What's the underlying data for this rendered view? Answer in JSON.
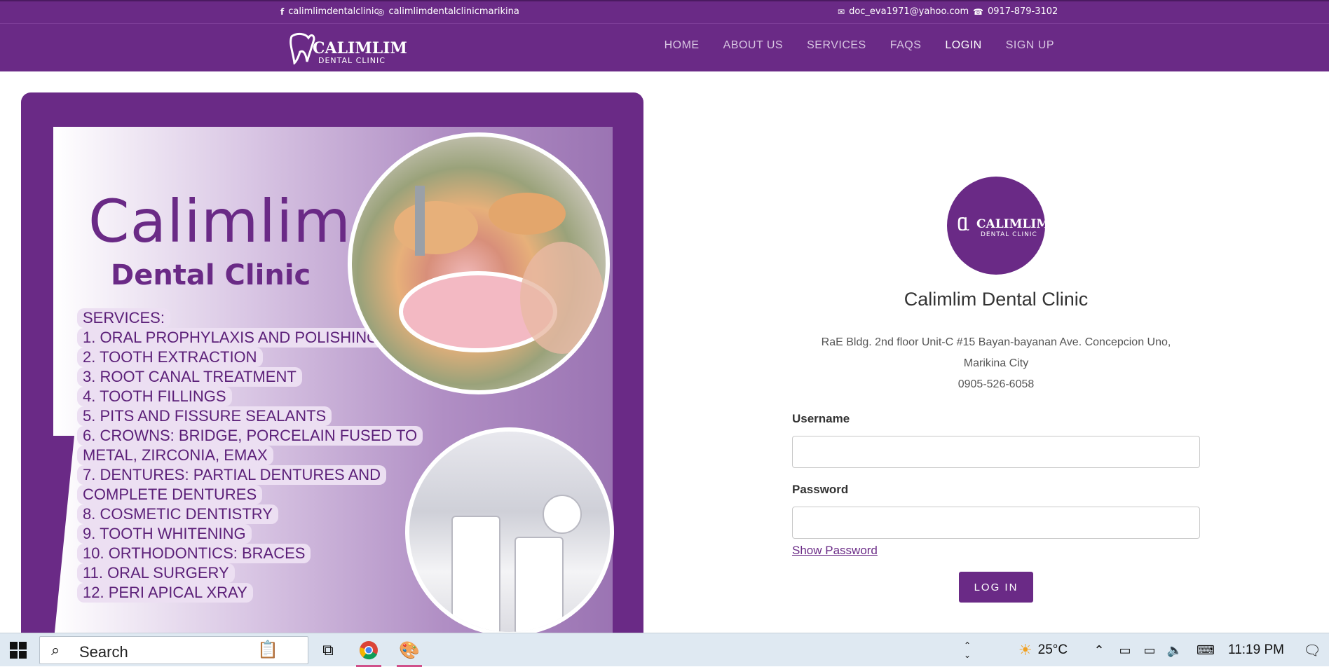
{
  "topbar": {
    "facebook": "calimlimdentalclinic",
    "instagram": "calimlimdentalclinicmarikina",
    "email": "doc_eva1971@yahoo.com",
    "phone": "0917-879-3102"
  },
  "logo": {
    "brand": "CALIMLIM",
    "sub": "DENTAL CLINIC"
  },
  "nav": [
    "HOME",
    "ABOUT US",
    "SERVICES",
    "FAQS",
    "LOGIN",
    "SIGN UP"
  ],
  "promo": {
    "title": "Calimlim",
    "subtitle": "Dental Clinic",
    "services_heading": "SERVICES:",
    "services": [
      "1.  ORAL PROPHYLAXIS AND POLISHING",
      "2.  TOOTH EXTRACTION",
      "3.  ROOT CANAL TREATMENT",
      "4.  TOOTH FILLINGS",
      "5.  PITS AND FISSURE SEALANTS",
      "6.  CROWNS: BRIDGE, PORCELAIN    FUSED TO",
      "METAL, ZIRCONIA, EMAX",
      "7.  DENTURES: PARTIAL DENTURES AND",
      "COMPLETE DENTURES",
      "8.  COSMETIC DENTISTRY",
      "9.  TOOTH WHITENING",
      "10. ORTHODONTICS: BRACES",
      "11. ORAL SURGERY",
      "12. PERI APICAL XRAY"
    ]
  },
  "login": {
    "clinic_name": "Calimlim Dental Clinic",
    "address_line1": "RaE Bldg. 2nd floor Unit-C #15 Bayan-bayanan Ave. Concepcion Uno,",
    "address_line2": "Marikina City",
    "phone": "0905-526-6058",
    "username_label": "Username",
    "password_label": "Password",
    "show_password": "Show Password",
    "button": "LOG IN"
  },
  "taskbar": {
    "search": "Search",
    "weather": "25°C",
    "time": "11:19 PM"
  },
  "colors": {
    "brand": "#6a2a86"
  }
}
